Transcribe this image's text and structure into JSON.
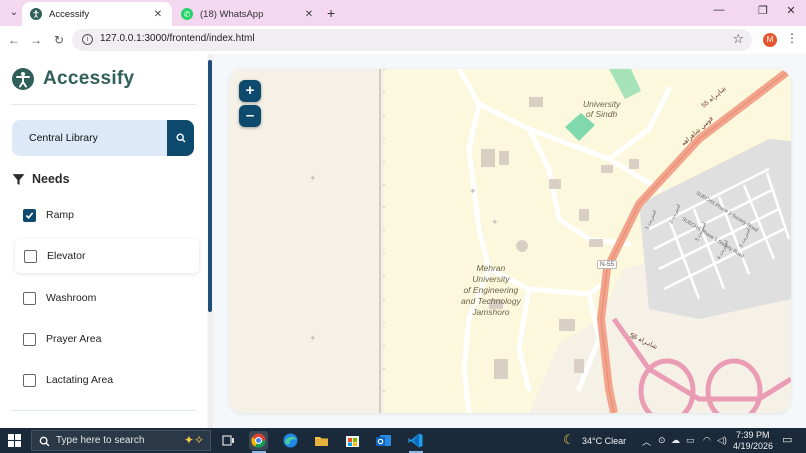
{
  "browser": {
    "tabs": [
      {
        "title": "Accessify",
        "active": true
      },
      {
        "title": "(18) WhatsApp",
        "active": false
      }
    ],
    "url": "127.0.0.1:3000/frontend/index.html",
    "profile_initial": "M"
  },
  "app": {
    "brand": "Accessify",
    "search": {
      "value": "Central Library",
      "placeholder": ""
    },
    "needs_title": "Needs",
    "needs": [
      {
        "label": "Ramp",
        "checked": true
      },
      {
        "label": "Elevator",
        "checked": false
      },
      {
        "label": "Washroom",
        "checked": false
      },
      {
        "label": "Prayer Area",
        "checked": false
      },
      {
        "label": "Lactating Area",
        "checked": false
      }
    ]
  },
  "map": {
    "zoom_in": "+",
    "zoom_out": "–",
    "labels": {
      "sindh_1": "University",
      "sindh_2": "of Sindh",
      "mehran_1": "Mehran",
      "mehran_2": "University",
      "mehran_3": "of Engineering",
      "mehran_4": "and Technology",
      "mehran_5": "Jamshoro",
      "road_n55": "N-55",
      "road_55_top": "55 شاہراہ",
      "road_55_bottom": "55 شاہراہ",
      "road_sindhi": "قومي شاهراهه",
      "society_1": "SUECHS Phase 2 Society Road",
      "society_2": "SUECHS Phase 1 Society Road",
      "street_1": "استريٽ 1",
      "street_2": "استريٽ 2",
      "street_3": "استريٽ 3",
      "street_4": "استريٽ 4",
      "street_5": "استريٽ 5"
    },
    "colors": {
      "background": "#f6f1e7",
      "campus": "#fbf8dd",
      "highway": "#f2a48c",
      "motorway": "#ea9cb5",
      "green": "#9de0b8",
      "building": "#d9cfc4",
      "residential": "#e0dfe0"
    }
  },
  "taskbar": {
    "search_label": "Type here to search",
    "weather": "34°C  Clear",
    "time": "7:39 PM",
    "date": "4/19/2026"
  }
}
